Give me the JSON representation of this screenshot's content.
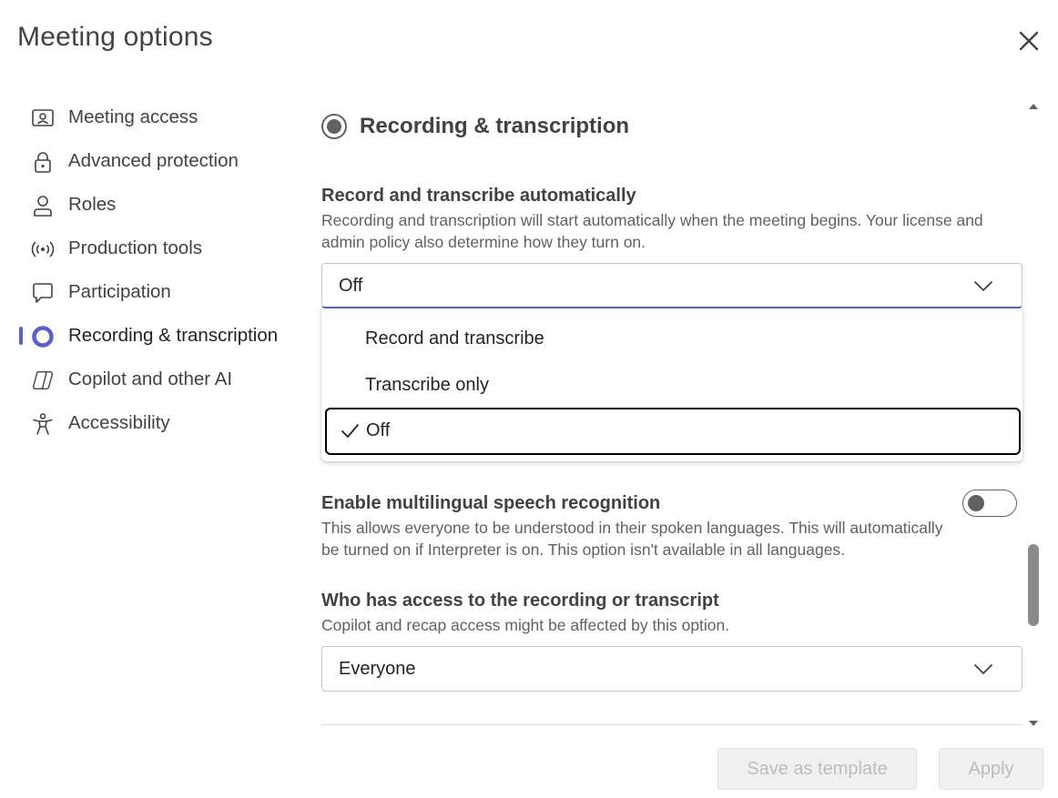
{
  "header": {
    "title": "Meeting options",
    "close_icon": "close-icon"
  },
  "sidebar": {
    "items": [
      {
        "label": "Meeting access",
        "icon": "meeting-access-icon"
      },
      {
        "label": "Advanced protection",
        "icon": "lock-icon"
      },
      {
        "label": "Roles",
        "icon": "person-icon"
      },
      {
        "label": "Production tools",
        "icon": "broadcast-icon"
      },
      {
        "label": "Participation",
        "icon": "chat-icon"
      },
      {
        "label": "Recording & transcription",
        "icon": "record-icon",
        "active": true
      },
      {
        "label": "Copilot and other AI",
        "icon": "copilot-icon"
      },
      {
        "label": "Accessibility",
        "icon": "accessibility-icon"
      }
    ],
    "accent_color": "#5b5fc7"
  },
  "main": {
    "section_title": "Recording & transcription",
    "record": {
      "title": "Record and transcribe automatically",
      "description": "Recording and transcription will start automatically when the meeting begins. Your license and admin policy also determine how they turn on.",
      "selected_value": "Off",
      "options": [
        "Record and transcribe",
        "Transcribe only",
        "Off"
      ]
    },
    "multilingual": {
      "title": "Enable multilingual speech recognition",
      "description": "This allows everyone to be understood in their spoken languages. This will automatically be turned on if Interpreter is on. This option isn't available in all languages.",
      "enabled": false
    },
    "access": {
      "title": "Who has access to the recording or transcript",
      "description": "Copilot and recap access might be affected by this option.",
      "selected_value": "Everyone"
    }
  },
  "footer": {
    "save_template_label": "Save as template",
    "apply_label": "Apply"
  }
}
